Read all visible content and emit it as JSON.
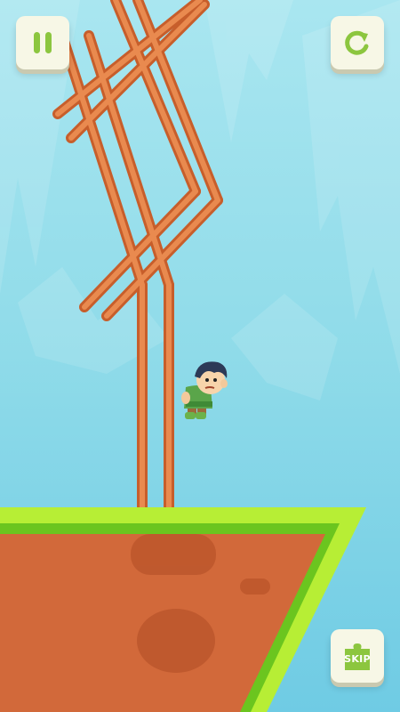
{
  "hud": {
    "pause_icon": "pause-icon",
    "restart_icon": "restart-icon",
    "skip_label": "SKIP",
    "skip_icon": "puzzle-piece-icon"
  },
  "colors": {
    "sky": "#7fd3e8",
    "button_face": "#f7f7e6",
    "button_icon": "#8cc63f",
    "stick": "#d9733b",
    "ground_fill": "#d2693a",
    "ground_border": "#b7ee35",
    "ground_inner_border": "#6bc51f"
  }
}
